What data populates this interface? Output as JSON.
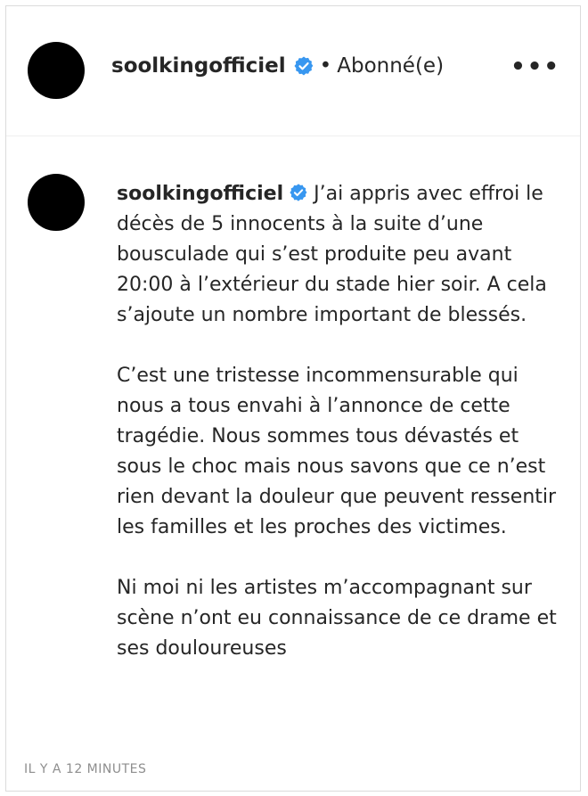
{
  "header": {
    "username": "soolkingofficiel",
    "separator": "•",
    "follow_state": "Abonné(e)",
    "more_label": "•••"
  },
  "comment": {
    "username": "soolkingofficiel",
    "paragraphs": [
      "J’ai appris avec effroi le décès de 5 innocents à la suite d’une bousculade qui s’est produite peu avant 20:00 à l’extérieur du stade hier soir. A cela s’ajoute un nombre important de blessés.",
      "C’est une tristesse incommensurable qui nous a tous envahi à l’annonce de cette tragédie. Nous sommes tous dévastés et sous le choc mais nous savons que ce n’est rien devant la douleur que peuvent ressentir les familles et les proches des victimes.",
      "Ni moi ni les artistes m’accompagnant sur scène n’ont eu connaissance de ce drame et ses douloureuses"
    ]
  },
  "timestamp": "IL Y A 12 MINUTES",
  "colors": {
    "verified_badge": "#3897f0",
    "text": "#262626",
    "muted": "#8e8e8e",
    "border": "#dbdbdb"
  },
  "icons": {
    "verified": "verified-badge-icon",
    "more": "more-options-icon"
  }
}
